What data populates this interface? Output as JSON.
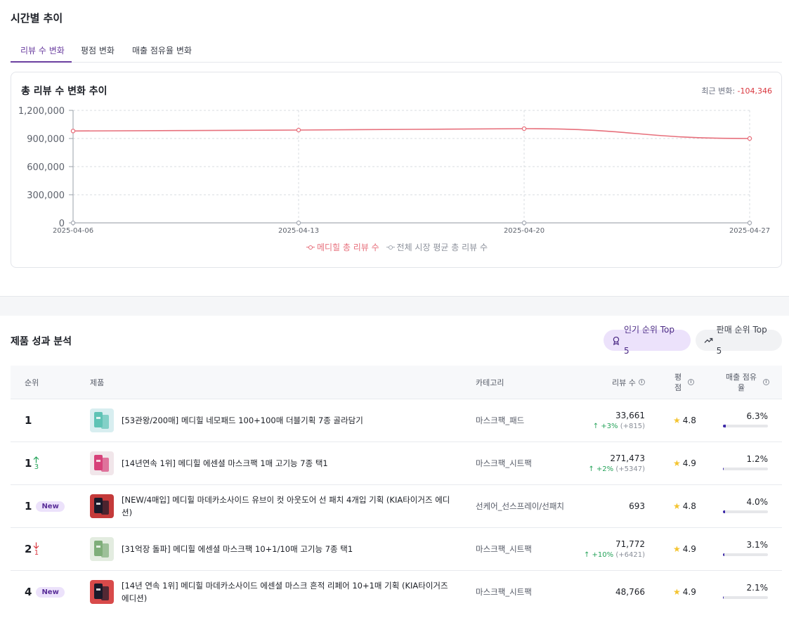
{
  "trend": {
    "title": "시간별 추이",
    "tabs": [
      "리뷰 수 변화",
      "평점 변화",
      "매출 점유율 변화"
    ],
    "card_title": "총 리뷰 수 변화 추이",
    "recent_label": "최근 변화:",
    "recent_value": "-104,346"
  },
  "chart_data": {
    "type": "line",
    "x": [
      "2025-04-06",
      "2025-04-13",
      "2025-04-20",
      "2025-04-27"
    ],
    "ylim": [
      0,
      1200000
    ],
    "yticks": [
      "0",
      "300,000",
      "600,000",
      "900,000",
      "1,200,000"
    ],
    "series": [
      {
        "name": "메디힐 총 리뷰 수",
        "color": "#e7707c",
        "values": [
          980000,
          990000,
          1005000,
          900000
        ]
      },
      {
        "name": "전체 시장 평균 총 리뷰 수",
        "color": "#a7acb5",
        "values": [
          0,
          0,
          0,
          0
        ]
      }
    ],
    "grid": true
  },
  "products": {
    "title": "제품 성과 분석",
    "toggle_popular": "인기 순위 Top 5",
    "toggle_sales": "판매 순위 Top 5",
    "headers": {
      "rank": "순위",
      "product": "제품",
      "category": "카테고리",
      "reviews": "리뷰 수",
      "rating": "평점",
      "share": "매출 점유율"
    },
    "rows": [
      {
        "rank": "1",
        "move": "",
        "move_dir": "",
        "is_new": false,
        "name": "[53관왕/200매] 메디힐 네모패드 100+100매 더블기획 7종 골라담기",
        "category": "마스크팩_패드",
        "reviews": "33,661",
        "review_change": "↑ +3%",
        "review_change_abs": "(+815)",
        "rating": "4.8",
        "share": "6.3%",
        "share_value": 0.063,
        "thumb_colors": [
          "#5fc3b5",
          "#d8eef0"
        ]
      },
      {
        "rank": "1",
        "move": "3",
        "move_dir": "up",
        "is_new": false,
        "name": "[14년연속 1위] 메디힐 에센셜 마스크팩 1매 고기능 7종 택1",
        "category": "마스크팩_시트팩",
        "reviews": "271,473",
        "review_change": "↑ +2%",
        "review_change_abs": "(+5347)",
        "rating": "4.9",
        "share": "1.2%",
        "share_value": 0.012,
        "thumb_colors": [
          "#d7427a",
          "#f1e6ea"
        ]
      },
      {
        "rank": "1",
        "move": "",
        "move_dir": "",
        "is_new": true,
        "new_label": "New",
        "name": "[NEW/4매입] 메디힐 마데카소사이드 유브이 컷 아웃도어 선 패치 4개입 기획 (KIA타이거즈 에디션)",
        "category": "선케어_선스프레이/선패치",
        "reviews": "693",
        "review_change": "",
        "review_change_abs": "",
        "rating": "4.8",
        "share": "4.0%",
        "share_value": 0.04,
        "thumb_colors": [
          "#1a1a2a",
          "#c43a3a"
        ]
      },
      {
        "rank": "2",
        "move": "1",
        "move_dir": "down",
        "is_new": false,
        "name": "[31억장 돌파] 메디힐 에센셜 마스크팩 10+1/10매 고기능 7종 택1",
        "category": "마스크팩_시트팩",
        "reviews": "71,772",
        "review_change": "↑ +10%",
        "review_change_abs": "(+6421)",
        "rating": "4.9",
        "share": "3.1%",
        "share_value": 0.031,
        "thumb_colors": [
          "#7fae7a",
          "#e3ece0"
        ]
      },
      {
        "rank": "4",
        "move": "",
        "move_dir": "",
        "is_new": true,
        "new_label": "New",
        "name": "[14년 연속 1위] 메디힐 마데카소사이드 에센셜 마스크 흔적 리페어 10+1매 기획 (KIA타이거즈 에디션)",
        "category": "마스크팩_시트팩",
        "reviews": "48,766",
        "review_change": "",
        "review_change_abs": "",
        "rating": "4.9",
        "share": "2.1%",
        "share_value": 0.021,
        "thumb_colors": [
          "#1a1a2a",
          "#d84a4a"
        ]
      }
    ]
  }
}
